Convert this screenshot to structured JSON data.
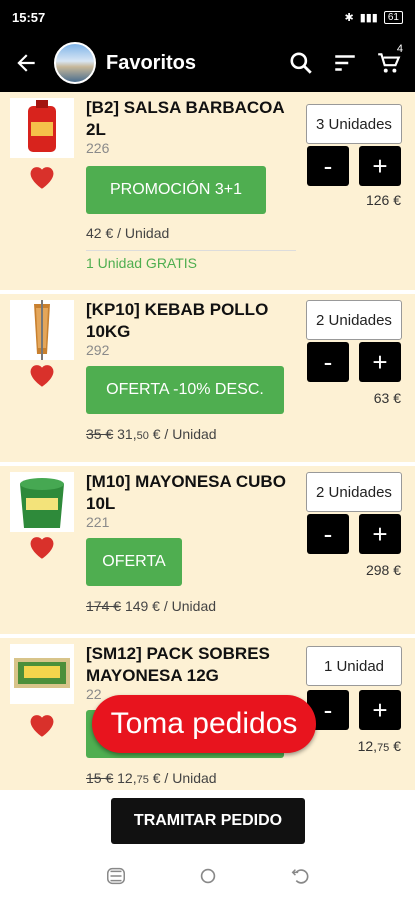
{
  "status": {
    "time": "15:57",
    "battery": "61"
  },
  "header": {
    "title": "Favoritos",
    "cart_count": "4"
  },
  "items": [
    {
      "name": "[B2] SALSA BARBACOA 2L",
      "code": "226",
      "promo": "PROMOCIÓN 3+1",
      "price": "42 € / Unidad",
      "old_price": "",
      "price_int": "",
      "price_dec": "",
      "extra": "1 Unidad GRATIS",
      "qty": "3 Unidades",
      "total": "126 €"
    },
    {
      "name": "[KP10] KEBAB POLLO 10KG",
      "code": "292",
      "promo": "OFERTA -10% DESC.",
      "old_price": "35 €",
      "price_int": "31,",
      "price_dec": "50",
      "price_unit": " € / Unidad",
      "qty": "2 Unidades",
      "total": "63 €"
    },
    {
      "name": "[M10] MAYONESA CUBO 10L",
      "code": "221",
      "promo": "OFERTA",
      "old_price": "174 €",
      "price_int": "149 €",
      "price_dec": "",
      "price_unit": " / Unidad",
      "qty": "2 Unidades",
      "total": "298 €"
    },
    {
      "name": "[SM12] PACK SOBRES MAYONESA 12G",
      "code": "22",
      "promo": "",
      "old_price": "15 €",
      "price_int": "12,",
      "price_dec": "75",
      "price_unit": " € / Unidad",
      "qty": "1 Unidad",
      "total_int": "12,",
      "total_dec": "75",
      "total_unit": " €"
    }
  ],
  "overlay": {
    "toma_label": "Toma pedidos"
  },
  "footer": {
    "tramitar_label": "TRAMITAR PEDIDO"
  },
  "colors": {
    "promo_green": "#4fae50",
    "card_bg": "#fdf1d4",
    "toma_red": "#e8141e"
  }
}
